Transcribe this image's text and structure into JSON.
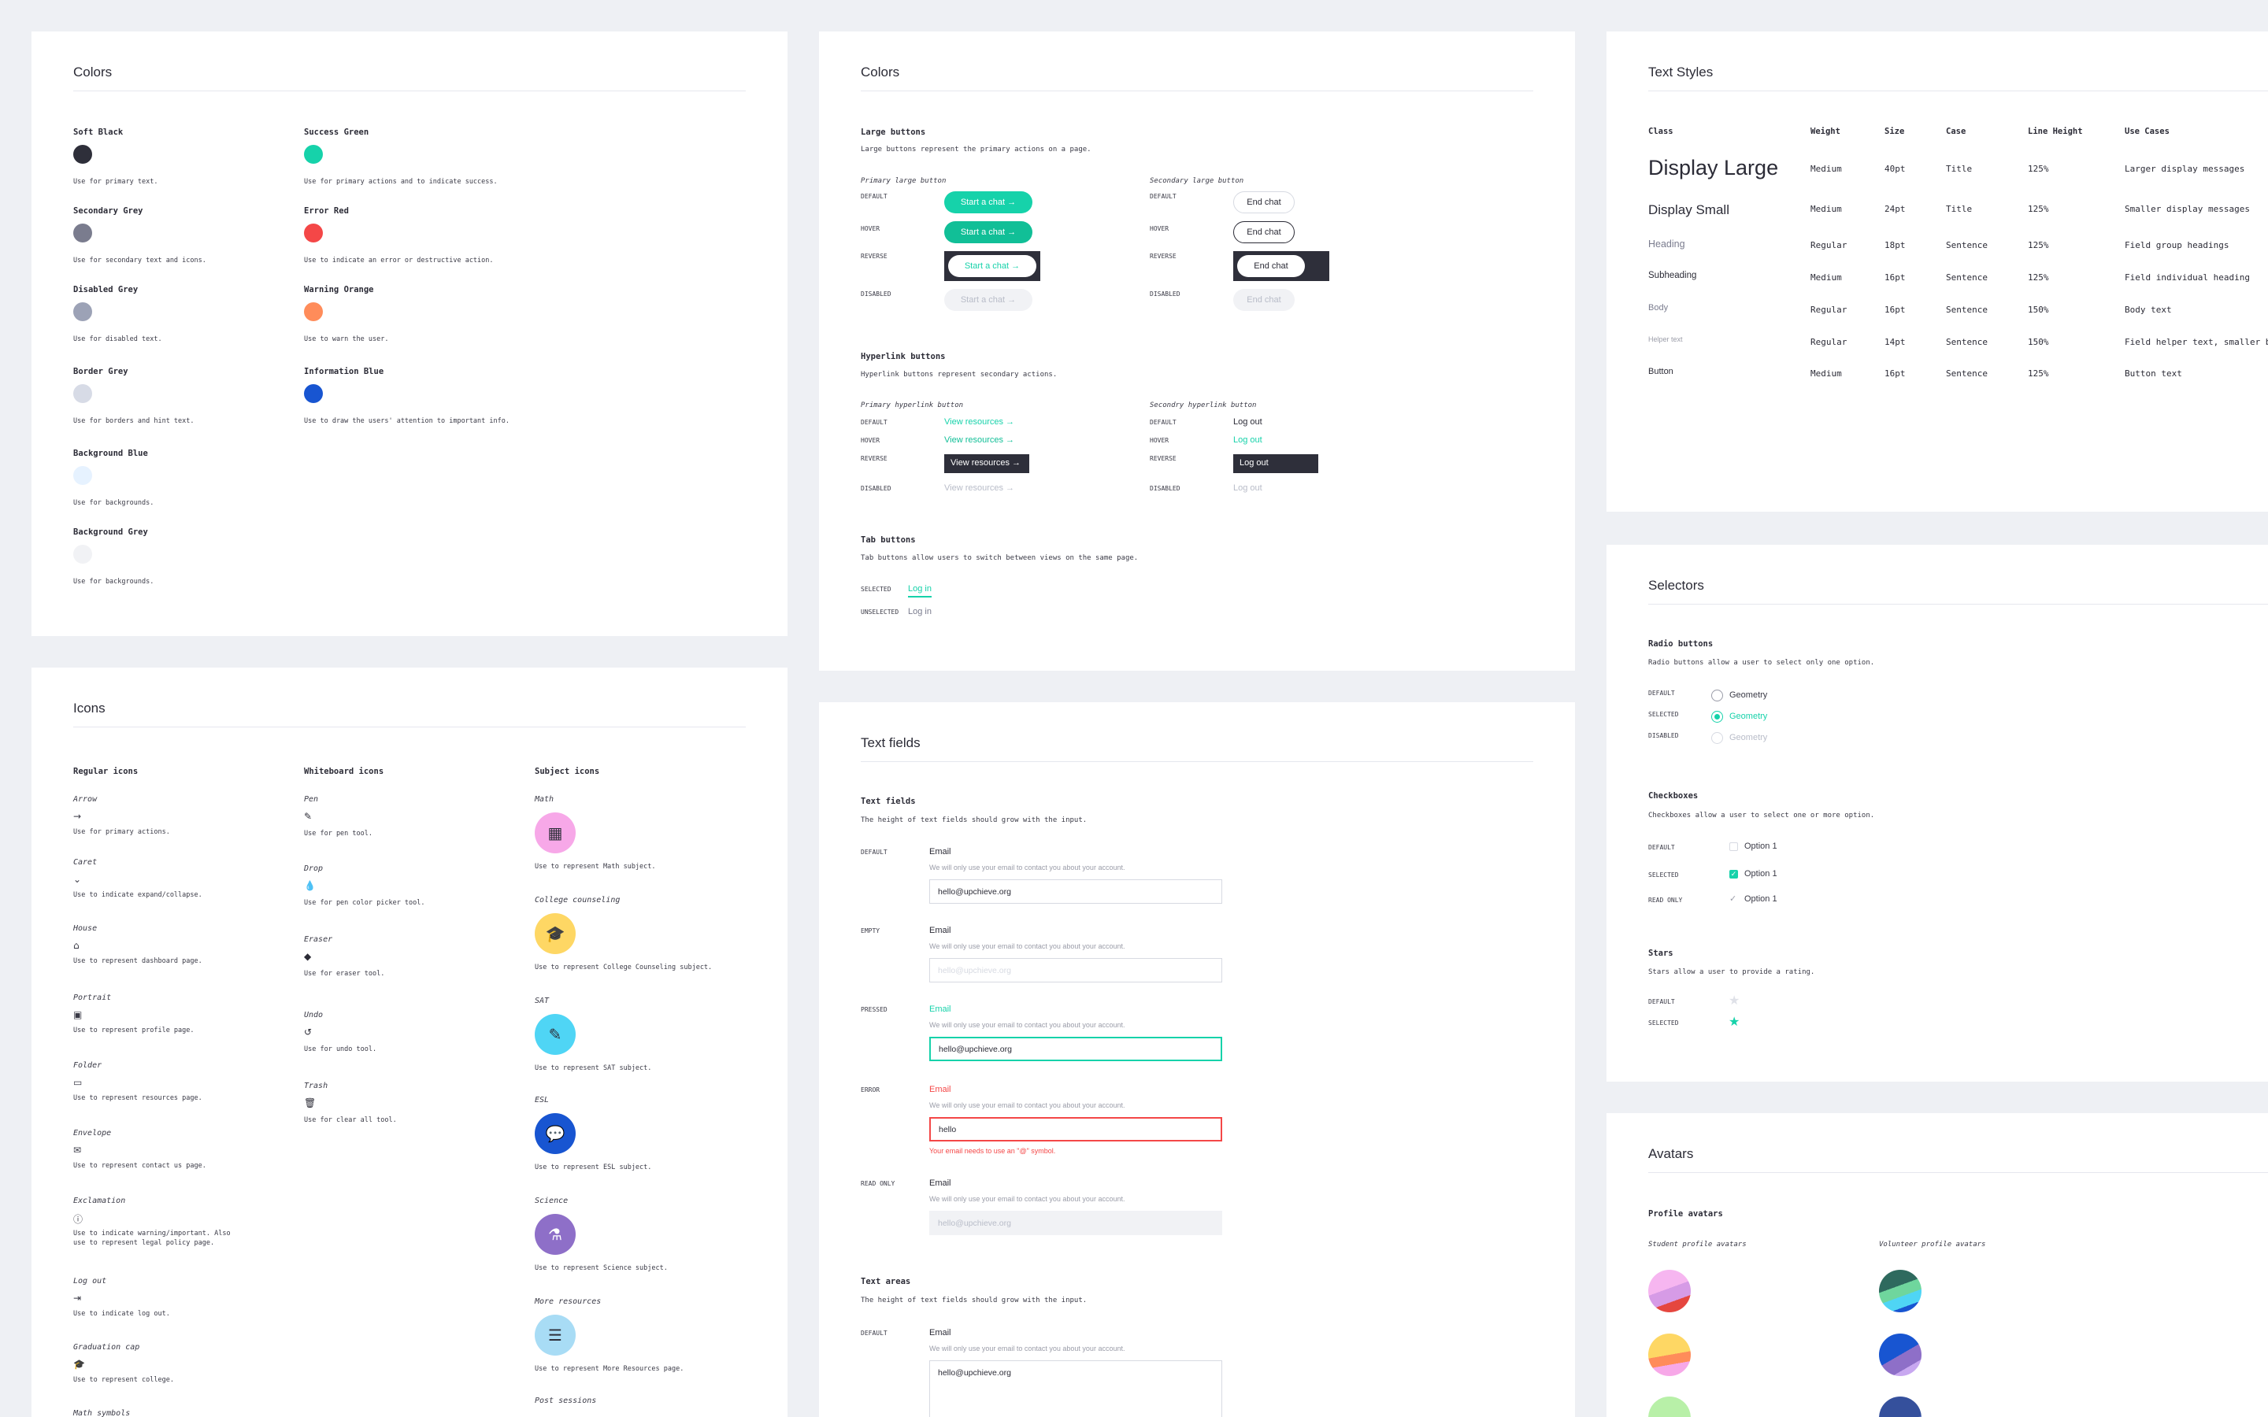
{
  "colors_card": {
    "title": "Colors",
    "items": [
      {
        "name": "Soft Black",
        "hex": "#2e2f3a",
        "desc": "Use for primary text."
      },
      {
        "name": "Secondary Grey",
        "hex": "#7a7c8e",
        "desc": "Use for secondary text and icons."
      },
      {
        "name": "Disabled Grey",
        "hex": "#9ca2b6",
        "desc": "Use for disabled text."
      },
      {
        "name": "Border Grey",
        "hex": "#d7dbe6",
        "desc": "Use for borders and hint text."
      },
      {
        "name": "Background Blue",
        "hex": "#e6f2ff",
        "desc": "Use for backgrounds."
      },
      {
        "name": "Background Grey",
        "hex": "#f1f2f5",
        "desc": "Use for backgrounds."
      },
      {
        "name": "Success Green",
        "hex": "#16d2aa",
        "desc": "Use for primary actions and to indicate success."
      },
      {
        "name": "Error Red",
        "hex": "#f44747",
        "desc": "Use to indicate an error or destructive action."
      },
      {
        "name": "Warning Orange",
        "hex": "#ff8c5a",
        "desc": "Use to warn the user."
      },
      {
        "name": "Information Blue",
        "hex": "#1855d1",
        "desc": "Use to draw the users' attention to important info."
      }
    ]
  },
  "buttons_card": {
    "title": "Colors",
    "large": {
      "heading": "Large buttons",
      "desc": "Large buttons represent the primary actions on a page.",
      "primary_caption": "Primary large button",
      "secondary_caption": "Secondary large button",
      "primary_label": "Start a chat →",
      "secondary_label": "End chat"
    },
    "hyperlink": {
      "heading": "Hyperlink buttons",
      "desc": "Hyperlink buttons represent secondary actions.",
      "primary_caption": "Primary hyperlink button",
      "secondary_caption": "Secondry hyperlink button",
      "primary_label": "View resources →",
      "secondary_label": "Log out"
    },
    "tab": {
      "heading": "Tab buttons",
      "desc": "Tab buttons allow users to switch between views on the same page.",
      "selected_state": "Selected",
      "unselected_state": "Unselected",
      "label": "Log in"
    },
    "states": {
      "default": "Default",
      "hover": "Hover",
      "reverse": "Reverse",
      "disabled": "Disabled"
    }
  },
  "text_styles_card": {
    "title": "Text Styles",
    "headers": [
      "Class",
      "Weight",
      "Size",
      "Case",
      "Line Height",
      "Use Cases"
    ],
    "rows": [
      {
        "cls": "Display Large",
        "weight": "Medium",
        "size": "40pt",
        "case": "Title",
        "lh": "125%",
        "use": "Larger display messages"
      },
      {
        "cls": "Display Small",
        "weight": "Medium",
        "size": "24pt",
        "case": "Title",
        "lh": "125%",
        "use": "Smaller display messages"
      },
      {
        "cls": "Heading",
        "weight": "Regular",
        "size": "18pt",
        "case": "Sentence",
        "lh": "125%",
        "use": "Field group headings"
      },
      {
        "cls": "Subheading",
        "weight": "Medium",
        "size": "16pt",
        "case": "Sentence",
        "lh": "125%",
        "use": "Field individual heading"
      },
      {
        "cls": "Body",
        "weight": "Regular",
        "size": "16pt",
        "case": "Sentence",
        "lh": "150%",
        "use": "Body text"
      },
      {
        "cls": "Helper text",
        "weight": "Regular",
        "size": "14pt",
        "case": "Sentence",
        "lh": "150%",
        "use": "Field helper text, smaller b"
      },
      {
        "cls": "Button",
        "weight": "Medium",
        "size": "16pt",
        "case": "Sentence",
        "lh": "125%",
        "use": "Button text"
      }
    ]
  },
  "selectors_card": {
    "title": "Selectors",
    "radio": {
      "heading": "Radio buttons",
      "desc": "Radio buttons allow a user to select only one option.",
      "option": "Geometry"
    },
    "checkbox": {
      "heading": "Checkboxes",
      "desc": "Checkboxes allow a user to select one or more option.",
      "option": "Option 1"
    },
    "stars": {
      "heading": "Stars",
      "desc": "Stars allow a user to provide a rating."
    },
    "states": {
      "default": "Default",
      "selected": "Selected",
      "disabled": "Disabled",
      "read_only": "Read only"
    }
  },
  "icons_card": {
    "title": "Icons",
    "regular": {
      "heading": "Regular icons",
      "items": [
        {
          "name": "Arrow",
          "icon": "arrow-icon",
          "desc": "Use for primary actions."
        },
        {
          "name": "Caret",
          "icon": "caret-icon",
          "desc": "Use to indicate expand/collapse."
        },
        {
          "name": "House",
          "icon": "house-icon",
          "desc": "Use to represent dashboard page."
        },
        {
          "name": "Portrait",
          "icon": "portrait-icon",
          "desc": "Use to represent profile page."
        },
        {
          "name": "Folder",
          "icon": "folder-icon",
          "desc": "Use to represent resources page."
        },
        {
          "name": "Envelope",
          "icon": "envelope-icon",
          "desc": "Use to represent contact us page."
        },
        {
          "name": "Exclamation",
          "icon": "exclamation-icon",
          "desc": "Use to indicate warning/important. Also",
          "desc2": "use to represent legal policy page."
        },
        {
          "name": "Log out",
          "icon": "log-out-icon",
          "desc": "Use to indicate log out."
        },
        {
          "name": "Graduation cap",
          "icon": "graduation-cap-icon",
          "desc": "Use to represent college."
        },
        {
          "name": "Math symbols",
          "icon": "math-symbols-icon",
          "desc": ""
        }
      ]
    },
    "whiteboard": {
      "heading": "Whiteboard icons",
      "items": [
        {
          "name": "Pen",
          "icon": "pen-icon",
          "desc": "Use for pen tool."
        },
        {
          "name": "Drop",
          "icon": "drop-icon",
          "desc": "Use for pen color picker tool."
        },
        {
          "name": "Eraser",
          "icon": "eraser-icon",
          "desc": "Use for eraser tool."
        },
        {
          "name": "Undo",
          "icon": "undo-icon",
          "desc": "Use for undo tool."
        },
        {
          "name": "Trash",
          "icon": "trash-icon",
          "desc": "Use for clear all tool."
        }
      ]
    },
    "subject": {
      "heading": "Subject icons",
      "items": [
        {
          "name": "Math",
          "icon": "calculator-icon",
          "bg": "#f7a8e8",
          "desc": "Use to represent Math subject."
        },
        {
          "name": "College counseling",
          "icon": "graduation-cap-icon",
          "bg": "#fed764",
          "desc": "Use to represent College Counseling subject."
        },
        {
          "name": "SAT",
          "icon": "notepad-icon",
          "bg": "#4fd5f5",
          "desc": "Use to represent SAT subject."
        },
        {
          "name": "ESL",
          "icon": "speech-bubble-icon",
          "bg": "#1855d1",
          "desc": "Use to represent ESL subject."
        },
        {
          "name": "Science",
          "icon": "flask-icon",
          "bg": "#8e6fc8",
          "desc": "Use to represent Science subject."
        },
        {
          "name": "More resources",
          "icon": "books-icon",
          "bg": "#a8dcf5",
          "desc": "Use to represent More Resources page."
        },
        {
          "name": "Post sessions",
          "icon": "",
          "bg": "#ffffff",
          "desc": ""
        }
      ]
    }
  },
  "textfields_card": {
    "title": "Text fields",
    "fields": {
      "heading": "Text fields",
      "desc": "The height of text fields should grow with the input.",
      "label": "Email",
      "help": "We will only use your email to contact you about your account.",
      "value": "hello@upchieve.org",
      "placeholder": "hello@upchieve.org",
      "error_value": "hello",
      "error_msg": "Your email needs to use an \"@\" symbol.",
      "states": {
        "default": "Default",
        "empty": "Empty",
        "pressed": "Pressed",
        "error": "Error",
        "read_only": "Read only"
      }
    },
    "areas": {
      "heading": "Text areas",
      "desc": "The height of text fields should grow with the input.",
      "label": "Email",
      "help": "We will only use your email to contact you about your account.",
      "value": "hello@upchieve.org",
      "state": "Default"
    }
  },
  "avatars_card": {
    "title": "Avatars",
    "heading": "Profile avatars",
    "student_caption": "Student profile avatars",
    "volunteer_caption": "Volunteer profile avatars"
  },
  "colors_ui": {
    "green": "#16d2aa",
    "dark": "#2e2f3a",
    "red": "#f44747",
    "disabled": "#b8bcc8",
    "border": "#d7dae2"
  }
}
